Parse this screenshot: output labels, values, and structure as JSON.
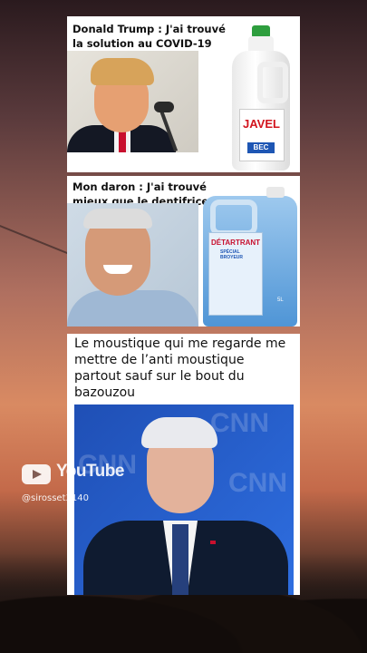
{
  "meme1": {
    "caption": "Donald Trump : J'ai trouvé la solution au COVID-19",
    "bottle_brand": "JAVEL",
    "bottle_tag": "BEC"
  },
  "meme2": {
    "caption": "Mon daron : J'ai trouvé mieux que le dentifrice",
    "bottle_brand": "DÉTARTRANT",
    "bottle_sub": "SPÉCIAL BROYEUR",
    "bottle_volume": "5L"
  },
  "meme3": {
    "caption": "Le moustique qui me regarde me mettre de l’anti moustique partout sauf sur le bout du bazouzou",
    "background_text": "CNN"
  },
  "watermark": {
    "platform": "YouTube",
    "handle": "@sirosset3140"
  }
}
